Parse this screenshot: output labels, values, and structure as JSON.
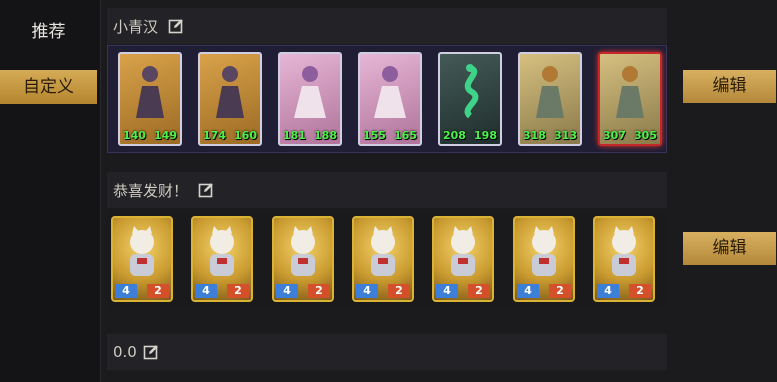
{
  "sidebar": {
    "tabs": [
      {
        "label": "推荐"
      },
      {
        "label": "自定义"
      }
    ]
  },
  "decks": [
    {
      "name": "小青汉",
      "cards": [
        {
          "left": "140",
          "right": "149",
          "label": "",
          "style": "gold"
        },
        {
          "left": "174",
          "right": "160",
          "label": "",
          "style": "gold"
        },
        {
          "left": "181",
          "right": "188",
          "label": "",
          "style": "gold"
        },
        {
          "left": "155",
          "right": "165",
          "label": "",
          "style": "gold"
        },
        {
          "left": "208",
          "right": "198",
          "label": "",
          "style": "ice"
        },
        {
          "left": "318",
          "right": "313",
          "label": "",
          "style": "gold"
        },
        {
          "left": "307",
          "right": "305",
          "label": "",
          "style": "selected"
        }
      ]
    },
    {
      "name": "恭喜发财！",
      "cards": [
        {
          "cost": "4",
          "power": "2"
        },
        {
          "cost": "4",
          "power": "2"
        },
        {
          "cost": "4",
          "power": "2"
        },
        {
          "cost": "4",
          "power": "2"
        },
        {
          "cost": "4",
          "power": "2"
        },
        {
          "cost": "4",
          "power": "2"
        },
        {
          "cost": "4",
          "power": "2"
        }
      ]
    },
    {
      "name": "0.0"
    }
  ],
  "buttons": {
    "edit1": "编辑",
    "edit2": "编辑"
  },
  "icons": {
    "edit": "edit-icon"
  },
  "colors": {
    "accent_gold": "#c9a04e",
    "stat_green": "#4df24a",
    "selected_red": "#c42828"
  }
}
